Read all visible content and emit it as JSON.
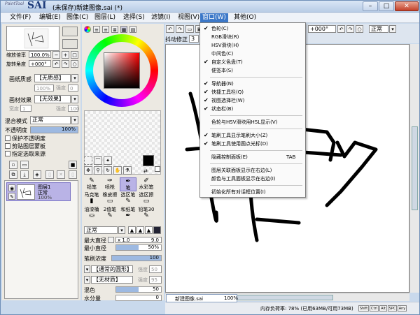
{
  "window": {
    "logo_small": "PaintTool",
    "logo_big": "SAI",
    "title": "(未保存)新建图像.sai (*)",
    "min_label": "–",
    "max_label": "□",
    "close_label": "✕"
  },
  "menubar": [
    {
      "label": "文件(F)"
    },
    {
      "label": "编辑(E)"
    },
    {
      "label": "图像(C)"
    },
    {
      "label": "图层(L)"
    },
    {
      "label": "选择(S)"
    },
    {
      "label": "滤镜(I)"
    },
    {
      "label": "视图(V)"
    },
    {
      "label": "窗口(W)"
    },
    {
      "label": "其他(O)"
    }
  ],
  "window_menu": [
    {
      "label": "色轮(C)",
      "checked": true
    },
    {
      "label": "RGB滑块(R)",
      "checked": false
    },
    {
      "label": "HSV滑块(H)",
      "checked": false
    },
    {
      "label": "中间色(C)",
      "checked": false
    },
    {
      "label": "自定义色盘(T)",
      "checked": true
    },
    {
      "label": "便签本(S)",
      "checked": false
    },
    {
      "label": "导航器(N)",
      "checked": true
    },
    {
      "label": "快捷工具栏(Q)",
      "checked": true
    },
    {
      "label": "视图选择栏(W)",
      "checked": true
    },
    {
      "label": "状态栏(B)",
      "checked": true
    },
    {
      "label": "色轮与HSV滑块用HSL显示(V)",
      "checked": false
    },
    {
      "label": "笔刷工具显示笔刷大小(Z)",
      "checked": true
    },
    {
      "label": "笔刷工具使用圆点光标(D)",
      "checked": true
    },
    {
      "label": "隐藏控制面板(E)",
      "checked": false,
      "shortcut": "TAB"
    },
    {
      "label": "图层关联面板显示在右边(L)",
      "checked": false
    },
    {
      "label": "颜色与工具面板显示在右边(I)",
      "checked": false
    },
    {
      "label": "初始化所有对话框位置(I)",
      "checked": false
    }
  ],
  "left_panel": {
    "zoom_label": "缩放倍率",
    "zoom_value": "100.0%",
    "rotate_label": "旋转角度",
    "rotate_value": "+000°",
    "paper_label": "画纸质感",
    "paper_value": "【无质感】",
    "paper_scale_value": "100%",
    "paper_strength_label": "强度",
    "paper_strength_value": "0",
    "effect_label": "画材效果",
    "effect_value": "【无效果】",
    "effect_width_label": "宽度",
    "effect_width_value": "1",
    "effect_strength_label": "强度",
    "effect_strength_value": "100",
    "blend_label": "混合模式",
    "blend_value": "正常",
    "opacity_label": "不透明度",
    "opacity_value": "100%",
    "opacity_fraction": 1.0,
    "check_preserve": "保护不透明度",
    "check_clip": "剪贴图层蒙板",
    "check_source": "指定选取来源",
    "layer_name": "图层1",
    "layer_mode": "正常",
    "layer_opacity": "100%"
  },
  "tool_panel": {
    "brushes": [
      {
        "name": "铅笔"
      },
      {
        "name": "喷枪"
      },
      {
        "name": "笔"
      },
      {
        "name": "水彩笔"
      },
      {
        "name": "马克笔"
      },
      {
        "name": "橡皮擦"
      },
      {
        "name": "选区笔"
      },
      {
        "name": "选区擦"
      },
      {
        "name": "油漆桶"
      },
      {
        "name": "2值笔"
      },
      {
        "name": "和纸笔"
      },
      {
        "name": "铅笔30"
      }
    ],
    "mode_value": "正常",
    "max_diameter_label": "最大直径",
    "max_diameter_mult": "x 1.0",
    "max_diameter_value": "9.0",
    "min_diameter_label": "最小直径",
    "min_diameter_value": "50%",
    "min_diameter_fraction": 0.5,
    "density_label": "笔刷浓度",
    "density_value": "100",
    "density_fraction": 1.0,
    "shape_value": "【通常的圆形】",
    "shape_strength_label": "强度",
    "shape_strength_value": "50",
    "texture_value": "【无材质】",
    "texture_strength_label": "强度",
    "texture_strength_value": "95",
    "mix_label": "混色",
    "mix_value": "50",
    "mix_fraction": 0.5,
    "water_label": "水分量",
    "water_value": "0",
    "water_fraction": 0.0
  },
  "canvas_toolbar": {
    "stabilizer_label": "抖动修正",
    "stabilizer_value": "3",
    "angle_value": "+000°",
    "mode_value": "正常"
  },
  "statusbar": {
    "doc_name": "新建图像.sai",
    "doc_zoom": "100%",
    "memory_text": "内存负荷率: 78% (已用63MB/可用73MB)",
    "indicators": [
      "Shift",
      "Ctrl",
      "Alt",
      "SPC",
      "Any"
    ]
  },
  "colors": {
    "accent": "#3c78c8",
    "layer_selected": "#b9b3e6"
  }
}
